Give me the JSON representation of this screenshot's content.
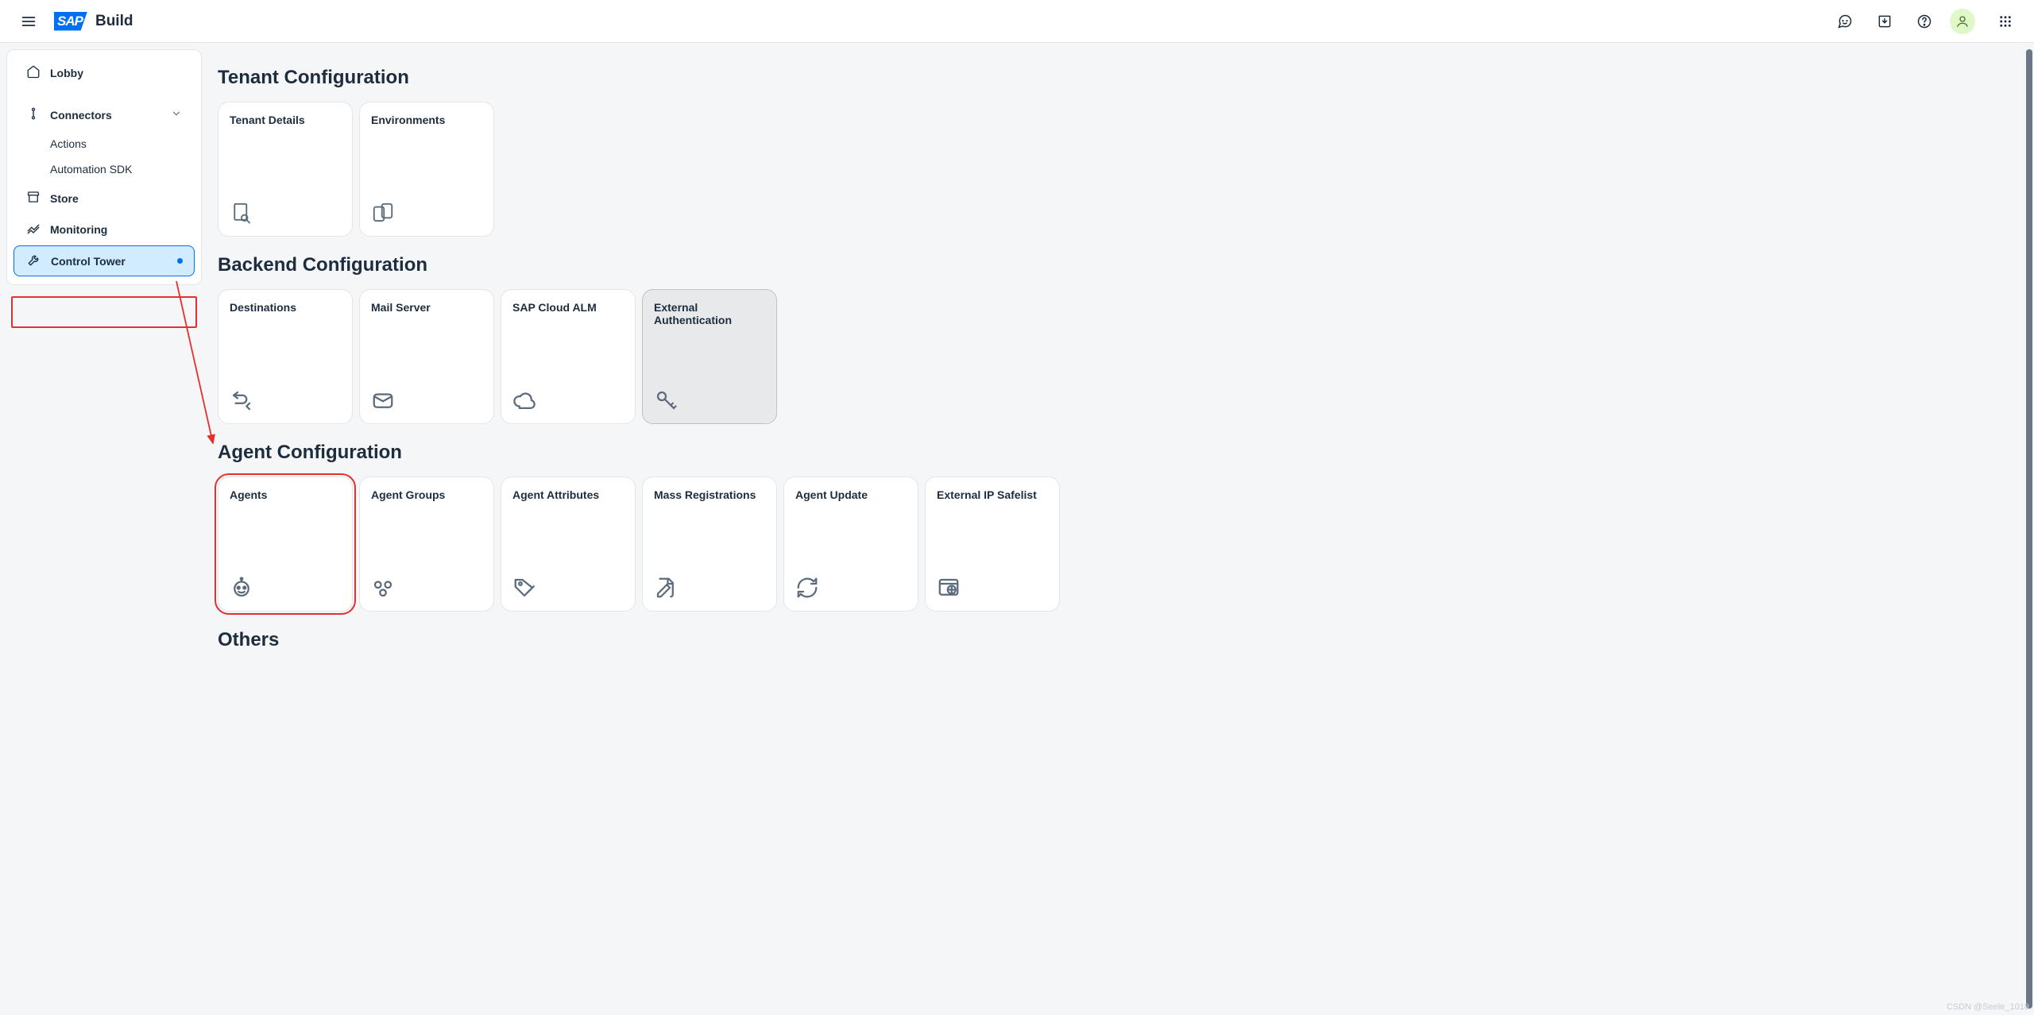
{
  "shell": {
    "product": "Build",
    "logo_text": "SAP"
  },
  "sidenav": {
    "lobby": "Lobby",
    "connectors": "Connectors",
    "actions": "Actions",
    "automation_sdk": "Automation SDK",
    "store": "Store",
    "monitoring": "Monitoring",
    "control_tower": "Control Tower"
  },
  "sections": {
    "tenant": {
      "title": "Tenant Configuration",
      "tiles": {
        "tenant_details": "Tenant Details",
        "environments": "Environments"
      }
    },
    "backend": {
      "title": "Backend Configuration",
      "tiles": {
        "destinations": "Destinations",
        "mail_server": "Mail Server",
        "sap_cloud_alm": "SAP Cloud ALM",
        "external_auth": "External Authentication"
      }
    },
    "agent": {
      "title": "Agent Configuration",
      "tiles": {
        "agents": "Agents",
        "agent_groups": "Agent Groups",
        "agent_attributes": "Agent Attributes",
        "mass_registrations": "Mass Registrations",
        "agent_update": "Agent Update",
        "external_ip": "External IP Safelist"
      }
    },
    "others": {
      "title": "Others"
    }
  },
  "watermark": "CSDN @Seele_1018"
}
